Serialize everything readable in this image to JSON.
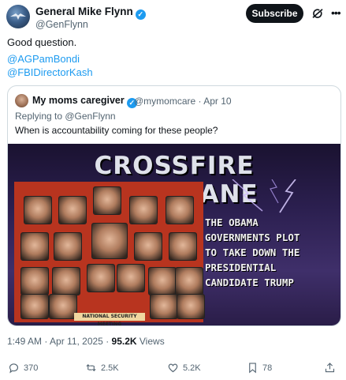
{
  "author": {
    "name": "General Mike Flynn",
    "handle": "@GenFlynn",
    "verified_icon": "verified-badge-icon"
  },
  "header": {
    "subscribe_label": "Subscribe",
    "grok_icon": "grok-icon",
    "more_icon": "more-icon"
  },
  "tweet": {
    "line1": "Good question.",
    "mention1": "@AGPamBondi",
    "mention2": "@FBIDirectorKash"
  },
  "quote": {
    "name": "My moms caregiver",
    "handle_time": "@mymomcare · Apr 10",
    "replying_to": "Replying to @GenFlynn",
    "text": "When is accountability coming for these people?",
    "image": {
      "title": "CROSSFIRE HURRICANE",
      "subtitle_lines": [
        "THE OBAMA",
        "GOVERNMENTS PLOT",
        "TO TAKE DOWN THE",
        "PRESIDENTIAL",
        "CANDIDATE TRUMP"
      ],
      "collage_caption": "NATIONAL SECURITY MEETING"
    }
  },
  "meta": {
    "time_date": "1:49 AM · Apr 11, 2025 · ",
    "views_count": "95.2K",
    "views_label": " Views"
  },
  "actions": {
    "replies": "370",
    "reposts": "2.5K",
    "likes": "5.2K",
    "bookmarks": "78"
  },
  "colors": {
    "accent": "#1d9bf0",
    "text": "#0f1419",
    "secondary": "#536471",
    "border": "#cfd9de"
  }
}
